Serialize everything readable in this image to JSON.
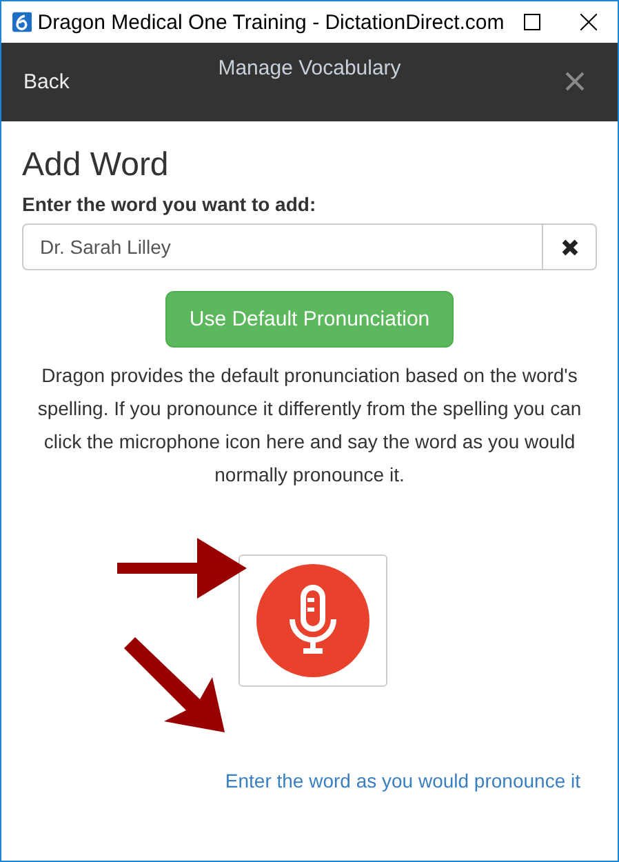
{
  "window": {
    "title": "Dragon Medical One Training - DictationDirect.com"
  },
  "header": {
    "back": "Back",
    "title": "Manage Vocabulary"
  },
  "form": {
    "heading": "Add Word",
    "label": "Enter the word you want to add:",
    "value": "Dr. Sarah Lilley",
    "default_button": "Use Default Pronunciation",
    "help": "Dragon provides the default pronunciation based on the word's spelling. If you pronounce it differently from the spelling you can click the microphone icon here and say the word as you would normally pronounce it.",
    "link": "Enter the word as you would pronounce it"
  }
}
